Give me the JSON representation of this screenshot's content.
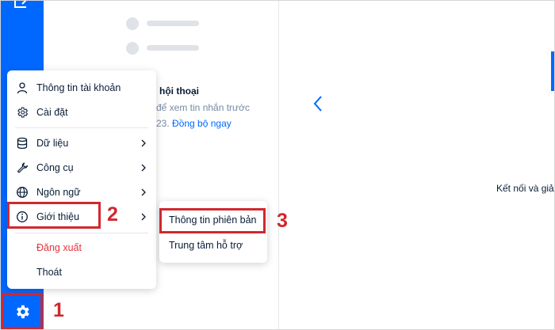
{
  "menu": {
    "items": [
      {
        "label": "Thông tin tài khoản",
        "icon": "user-icon"
      },
      {
        "label": "Cài đặt",
        "icon": "gear-icon"
      },
      {
        "label": "Dữ liệu",
        "icon": "database-icon"
      },
      {
        "label": "Công cụ",
        "icon": "wrench-icon"
      },
      {
        "label": "Ngôn ngữ",
        "icon": "globe-icon"
      },
      {
        "label": "Giới thiệu",
        "icon": "info-icon"
      },
      {
        "label": "Đăng xuất"
      },
      {
        "label": "Thoát"
      }
    ]
  },
  "submenu": {
    "items": [
      {
        "label": "Thông tin phiên bản"
      },
      {
        "label": "Trung tâm hỗ trợ"
      }
    ]
  },
  "sync_notice": {
    "title": "hội thoại",
    "description": "để xem tin nhắn trước",
    "line2_prefix": "23.",
    "link": "Đồng bộ ngay"
  },
  "right_pane": {
    "text": "Kết nối và giải"
  },
  "annotations": {
    "step1": "1",
    "step2": "2",
    "step3": "3"
  },
  "colors": {
    "brand": "#0068ff",
    "highlight": "#d0282e",
    "logout": "#e5343d"
  }
}
